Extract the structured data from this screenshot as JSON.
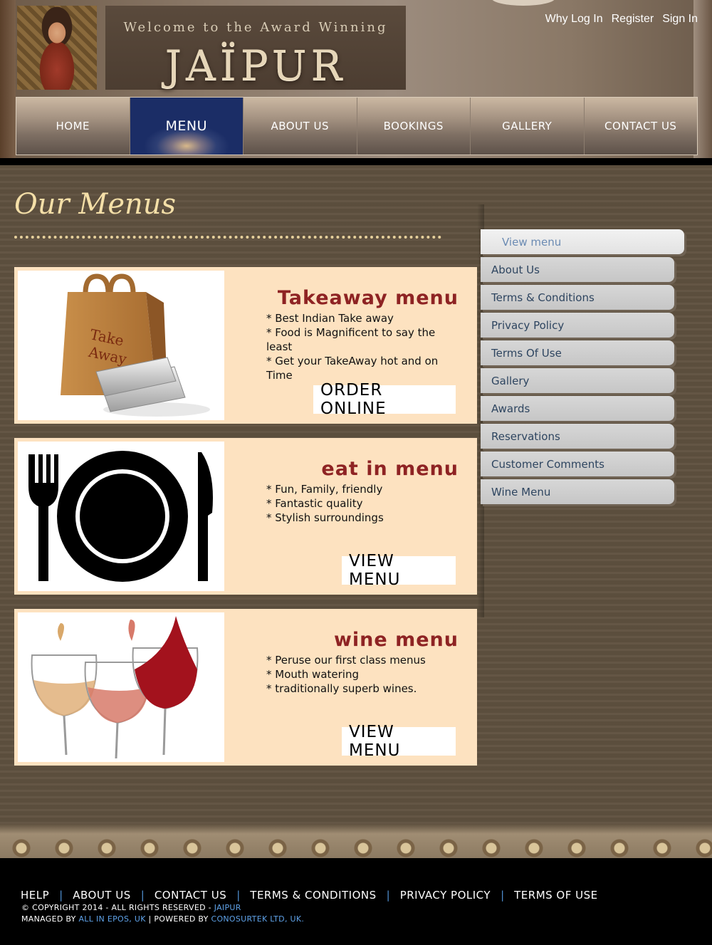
{
  "header": {
    "welcome": "Welcome to the Award Winning",
    "brand": "JAÏPUR",
    "top_links": [
      "Why Log In",
      "Register",
      "Sign In"
    ]
  },
  "nav": {
    "tabs": [
      "HOME",
      "MENU",
      "ABOUT US",
      "BOOKINGS",
      "GALLERY",
      "CONTACT US"
    ],
    "active": "MENU"
  },
  "page": {
    "title": "Our Menus"
  },
  "cards": [
    {
      "title": "Takeaway menu",
      "image": "takeaway-bag",
      "bullets": [
        "* Best Indian Take away",
        "* Food is Magnificent to say the least",
        "* Get your TakeAway hot and on Time"
      ],
      "button": "ORDER ONLINE"
    },
    {
      "title": "eat in menu",
      "image": "plate-fork-knife",
      "bullets": [
        "* Fun, Family, friendly",
        "* Fantastic quality",
        "* Stylish surroundings"
      ],
      "button": "VIEW MENU"
    },
    {
      "title": "wine menu",
      "image": "wine-glasses",
      "bullets": [
        "* Peruse our first class menus",
        "* Mouth watering",
        "* traditionally superb wines."
      ],
      "button": "VIEW MENU"
    }
  ],
  "sidebar": {
    "items": [
      "View menu",
      "About Us",
      "Terms & Conditions",
      "Privacy Policy",
      "Terms Of Use",
      "Gallery",
      "Awards",
      "Reservations",
      "Customer Comments",
      "Wine Menu"
    ]
  },
  "footer": {
    "links": [
      "HELP",
      "ABOUT US",
      "CONTACT US",
      "TERMS & CONDITIONS",
      "PRIVACY POLICY",
      "TERMS OF USE"
    ],
    "copyright_prefix": "© COPYRIGHT 2014 - ALL RIGHTS RESERVED -",
    "copyright_brand": "JAIPUR",
    "managed_prefix": "MANAGED BY",
    "managed_by": "ALL IN EPOS, UK",
    "powered_prefix": "| POWERED BY",
    "powered_by": "CONOSURTEK LTD, UK."
  },
  "colors": {
    "card_bg": "#fde2c0",
    "card_title": "#8e2323",
    "title_gold": "#f4dfa8",
    "footer_link_blue": "#5fa2e8"
  }
}
